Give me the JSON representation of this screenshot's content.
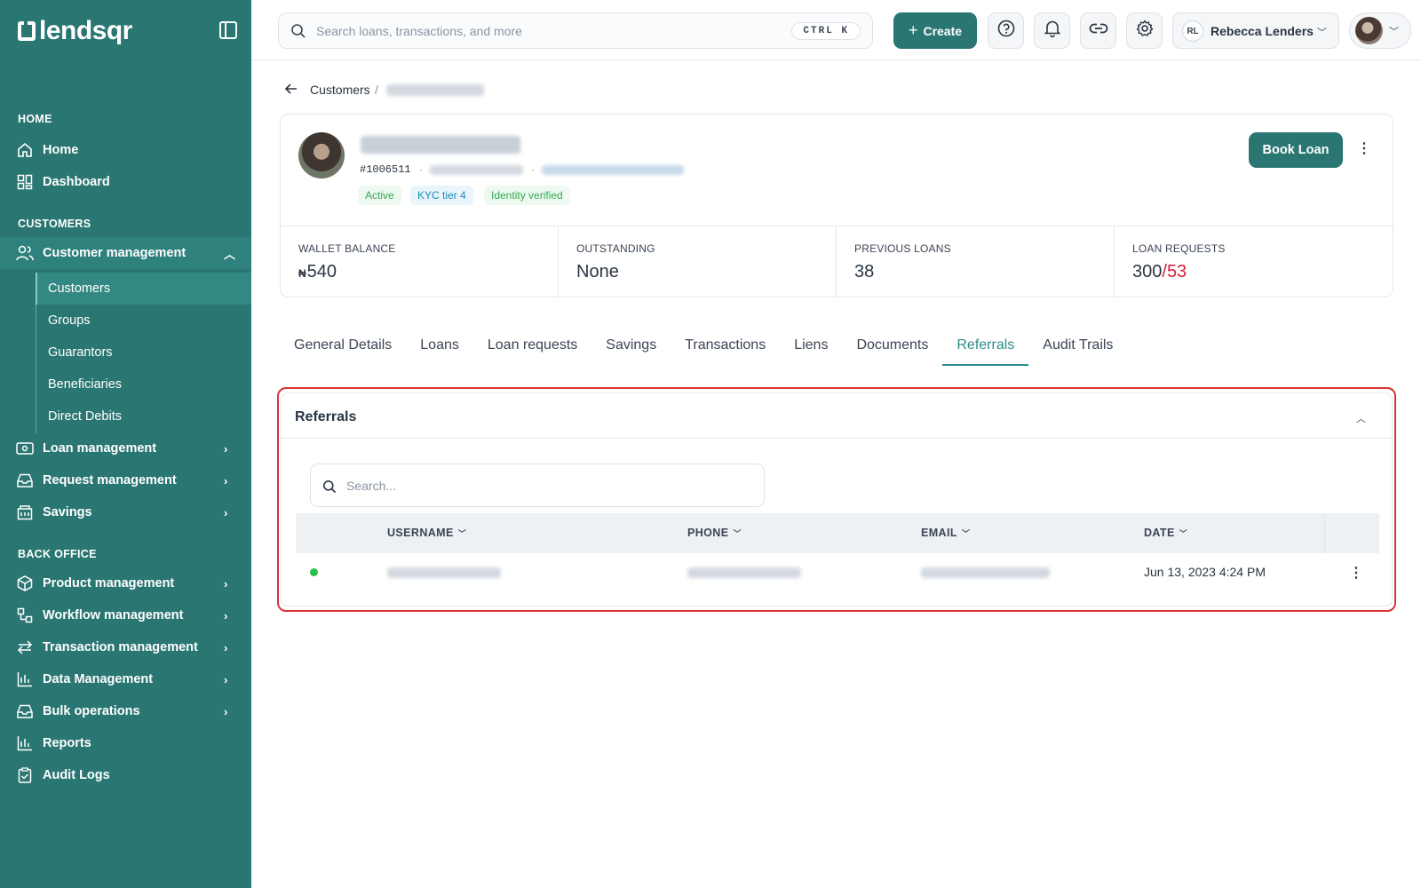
{
  "brand": {
    "name": "lendsqr"
  },
  "sidebar": {
    "sections": {
      "home": "HOME",
      "customers": "CUSTOMERS",
      "back_office": "BACK OFFICE"
    },
    "home_items": [
      {
        "label": "Home",
        "icon": "home-icon"
      },
      {
        "label": "Dashboard",
        "icon": "dashboard-icon"
      }
    ],
    "customer_management": {
      "label": "Customer management",
      "icon": "users-icon",
      "expanded": true
    },
    "customer_sub_items": [
      "Customers",
      "Groups",
      "Guarantors",
      "Beneficiaries",
      "Direct Debits"
    ],
    "customer_items": [
      {
        "label": "Loan management",
        "icon": "loan-icon"
      },
      {
        "label": "Request management",
        "icon": "inbox-icon"
      },
      {
        "label": "Savings",
        "icon": "savings-icon"
      }
    ],
    "back_office_items": [
      {
        "label": "Product management",
        "icon": "box-icon"
      },
      {
        "label": "Workflow management",
        "icon": "workflow-icon"
      },
      {
        "label": "Transaction management",
        "icon": "transfer-icon"
      },
      {
        "label": "Data Management",
        "icon": "chart-icon"
      },
      {
        "label": "Bulk operations",
        "icon": "inbox-icon"
      },
      {
        "label": "Reports",
        "icon": "chart-icon"
      },
      {
        "label": "Audit Logs",
        "icon": "clipboard-icon"
      }
    ]
  },
  "header": {
    "search_placeholder": "Search loans, transactions, and more",
    "shortcut": "CTRL K",
    "create_label": "Create",
    "user_initials": "RL",
    "user_name": "Rebecca Lenders"
  },
  "breadcrumb": {
    "parent": "Customers",
    "separator": "/"
  },
  "customer": {
    "id": "#1006511",
    "badges": [
      "Active",
      "KYC tier 4",
      "Identity verified"
    ],
    "book_loan_label": "Book Loan",
    "stats": {
      "wallet_balance": {
        "label": "WALLET BALANCE",
        "currency": "₦",
        "value": "540"
      },
      "outstanding": {
        "label": "OUTSTANDING",
        "value": "None"
      },
      "previous_loans": {
        "label": "PREVIOUS LOANS",
        "value": "38"
      },
      "loan_requests": {
        "label": "LOAN REQUESTS",
        "value_a": "300",
        "separator": "/",
        "value_b": "53"
      }
    }
  },
  "tabs": [
    "General Details",
    "Loans",
    "Loan requests",
    "Savings",
    "Transactions",
    "Liens",
    "Documents",
    "Referrals",
    "Audit Trails"
  ],
  "active_tab": "Referrals",
  "referrals": {
    "title": "Referrals",
    "search_placeholder": "Search...",
    "columns": [
      "USERNAME",
      "PHONE",
      "EMAIL",
      "DATE"
    ],
    "rows": [
      {
        "status": "active",
        "date": "Jun 13, 2023 4:24 PM"
      }
    ]
  },
  "colors": {
    "brand": "#2a7672",
    "accent": "#2a8e8a",
    "danger": "#d61f3a",
    "success": "#27c04a"
  }
}
